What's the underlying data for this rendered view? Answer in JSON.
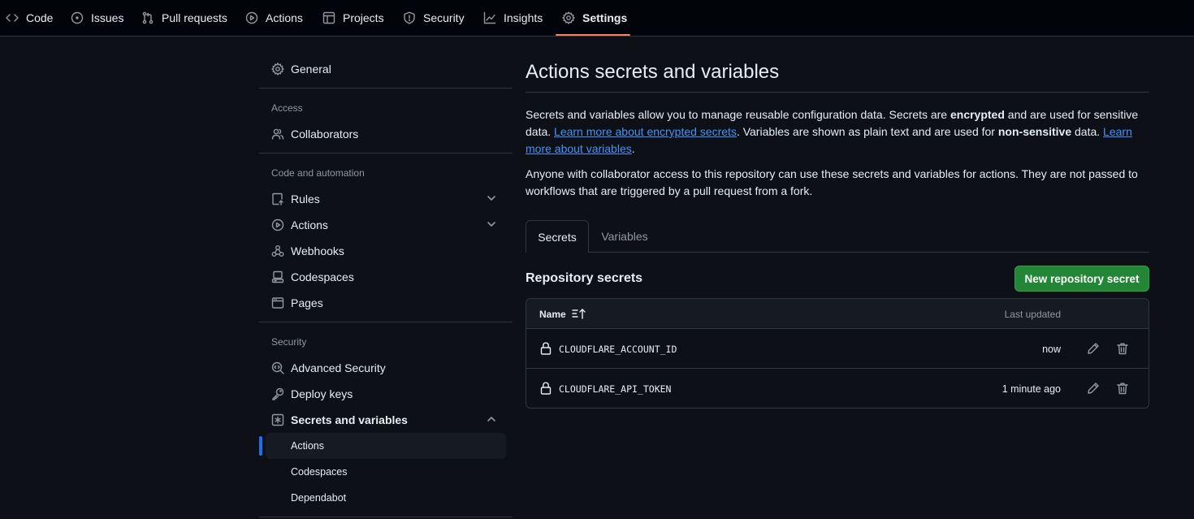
{
  "topnav": {
    "tabs": [
      {
        "label": "Code",
        "icon": "code-icon"
      },
      {
        "label": "Issues",
        "icon": "issue-icon"
      },
      {
        "label": "Pull requests",
        "icon": "pull-request-icon"
      },
      {
        "label": "Actions",
        "icon": "play-icon"
      },
      {
        "label": "Projects",
        "icon": "table-icon"
      },
      {
        "label": "Security",
        "icon": "shield-icon"
      },
      {
        "label": "Insights",
        "icon": "graph-icon"
      },
      {
        "label": "Settings",
        "icon": "gear-icon"
      }
    ],
    "selected": "Settings",
    "accent_color": "#f78166"
  },
  "sidebar": {
    "general": "General",
    "access_heading": "Access",
    "collaborators": "Collaborators",
    "code_automation_heading": "Code and automation",
    "rules": "Rules",
    "actions": "Actions",
    "webhooks": "Webhooks",
    "codespaces": "Codespaces",
    "pages": "Pages",
    "security_heading": "Security",
    "advanced_security": "Advanced Security",
    "deploy_keys": "Deploy keys",
    "secrets_and_variables": "Secrets and variables",
    "sub_actions": "Actions",
    "sub_codespaces": "Codespaces",
    "sub_dependabot": "Dependabot"
  },
  "main": {
    "title": "Actions secrets and variables",
    "intro": {
      "p1_a": "Secrets and variables allow you to manage reusable configuration data. Secrets are ",
      "p1_b": "encrypted",
      "p1_c": " and are used for sensitive data. ",
      "p1_link1": "Learn more about encrypted secrets",
      "p1_d": ". Variables are shown as plain text and are used for ",
      "p1_e": "non-sensitive",
      "p1_f": " data. ",
      "p1_link2": "Learn more about variables",
      "p1_g": ".",
      "p2": "Anyone with collaborator access to this repository can use these secrets and variables for actions. They are not passed to workflows that are triggered by a pull request from a fork."
    },
    "tabs": {
      "secrets": "Secrets",
      "variables": "Variables"
    },
    "section_title": "Repository secrets",
    "new_button": "New repository secret",
    "table": {
      "col_name": "Name",
      "col_updated": "Last updated",
      "rows": [
        {
          "name": "CLOUDFLARE_ACCOUNT_ID",
          "updated": "now"
        },
        {
          "name": "CLOUDFLARE_API_TOKEN",
          "updated": "1 minute ago"
        }
      ]
    },
    "button_color": "#238636",
    "link_color": "#4493f8"
  }
}
